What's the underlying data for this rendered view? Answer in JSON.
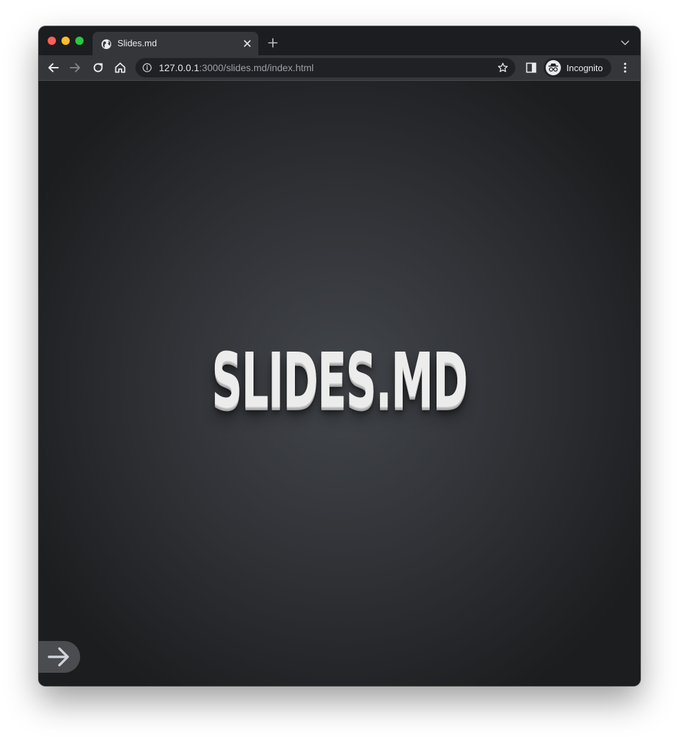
{
  "browser": {
    "tab": {
      "title": "Slides.md"
    },
    "address_bar": {
      "host": "127.0.0.1",
      "rest": ":3000/slides.md/index.html"
    },
    "profile": {
      "label": "Incognito"
    }
  },
  "slide": {
    "title": "SLIDES.MD"
  },
  "icons": {
    "tab_favicon": "globe-icon",
    "tab_close": "close-icon",
    "new_tab": "plus-icon",
    "back": "arrow-left-icon",
    "forward": "arrow-right-icon",
    "reload": "reload-icon",
    "home": "home-icon",
    "site_info": "info-icon",
    "bookmark": "star-icon",
    "side_panel": "side-panel-icon",
    "incognito": "incognito-icon",
    "menu": "kebab-menu-icon",
    "next_slide": "arrow-right-icon"
  },
  "colors": {
    "window_frame": "#1c1d20",
    "toolbar": "#35363a",
    "omnibox": "#202124",
    "slide_background_center": "#42454a",
    "slide_background_edge": "#1c1d1f",
    "slide_title": "#ececec",
    "traffic_close": "#fe5f57",
    "traffic_minimize": "#febc2e",
    "traffic_maximize": "#28c840"
  }
}
